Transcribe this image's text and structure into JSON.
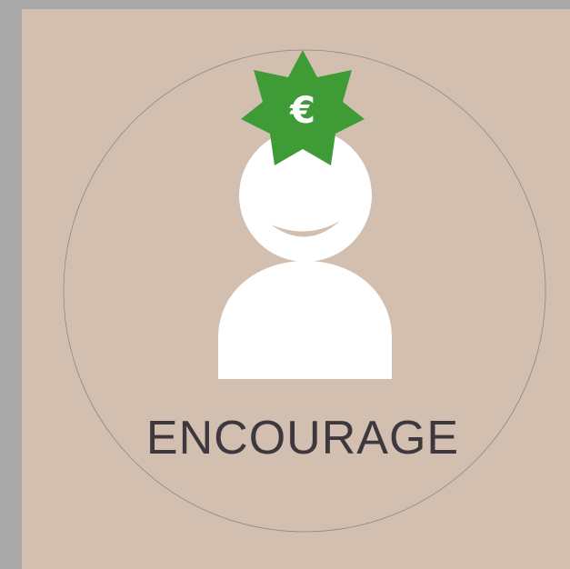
{
  "badge": {
    "label": "ENCOURAGE",
    "currency_symbol": "€",
    "icon": "person-with-euro-star-icon"
  },
  "colors": {
    "outer_frame": "#a9a9a9",
    "panel": "#d2bfaf",
    "circle_outline": "#8f8680",
    "figure": "#ffffff",
    "smile": "#d2bfaf",
    "star": "#3e9b35",
    "label_text": "#3d383e"
  }
}
